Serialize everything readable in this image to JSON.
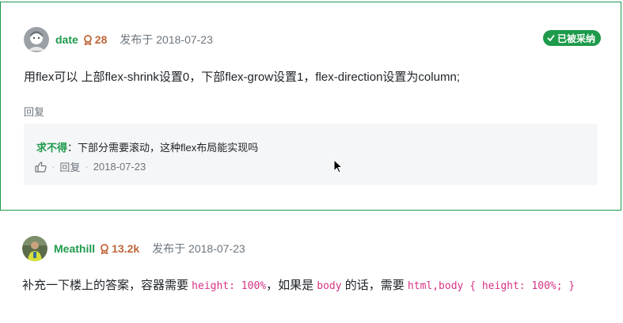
{
  "answer1": {
    "username": "date",
    "reputation": "28",
    "posted": "发布于 2018-07-23",
    "accepted_label": "已被采纳",
    "body": "用flex可以 上部flex-shrink设置0，下部flex-grow设置1，flex-direction设置为column;",
    "reply_label": "回复",
    "comment": {
      "author": "求不得",
      "separator": "：",
      "text": "下部分需要滚动，这种flex布局能实现吗",
      "reply_label": "回复",
      "date": "2018-07-23"
    }
  },
  "answer2": {
    "username": "Meathill",
    "reputation": "13.2k",
    "posted": "发布于 2018-07-23",
    "body_part1": "补充一下楼上的答案，容器需要 ",
    "code1": "height: 100%",
    "body_part2": "，如果是 ",
    "code2": "body",
    "body_part3": " 的话，需要 ",
    "code3": "html,body { height: 100%; }"
  },
  "colors": {
    "accent": "#1d9a4b",
    "reputation": "#c0663a",
    "code": "#d63384",
    "comment_bg": "#f5f6f7"
  },
  "icons": {
    "rep": "medal-icon",
    "accepted": "check-icon",
    "like": "thumbs-up-icon",
    "cursor": "mouse-cursor-icon"
  }
}
